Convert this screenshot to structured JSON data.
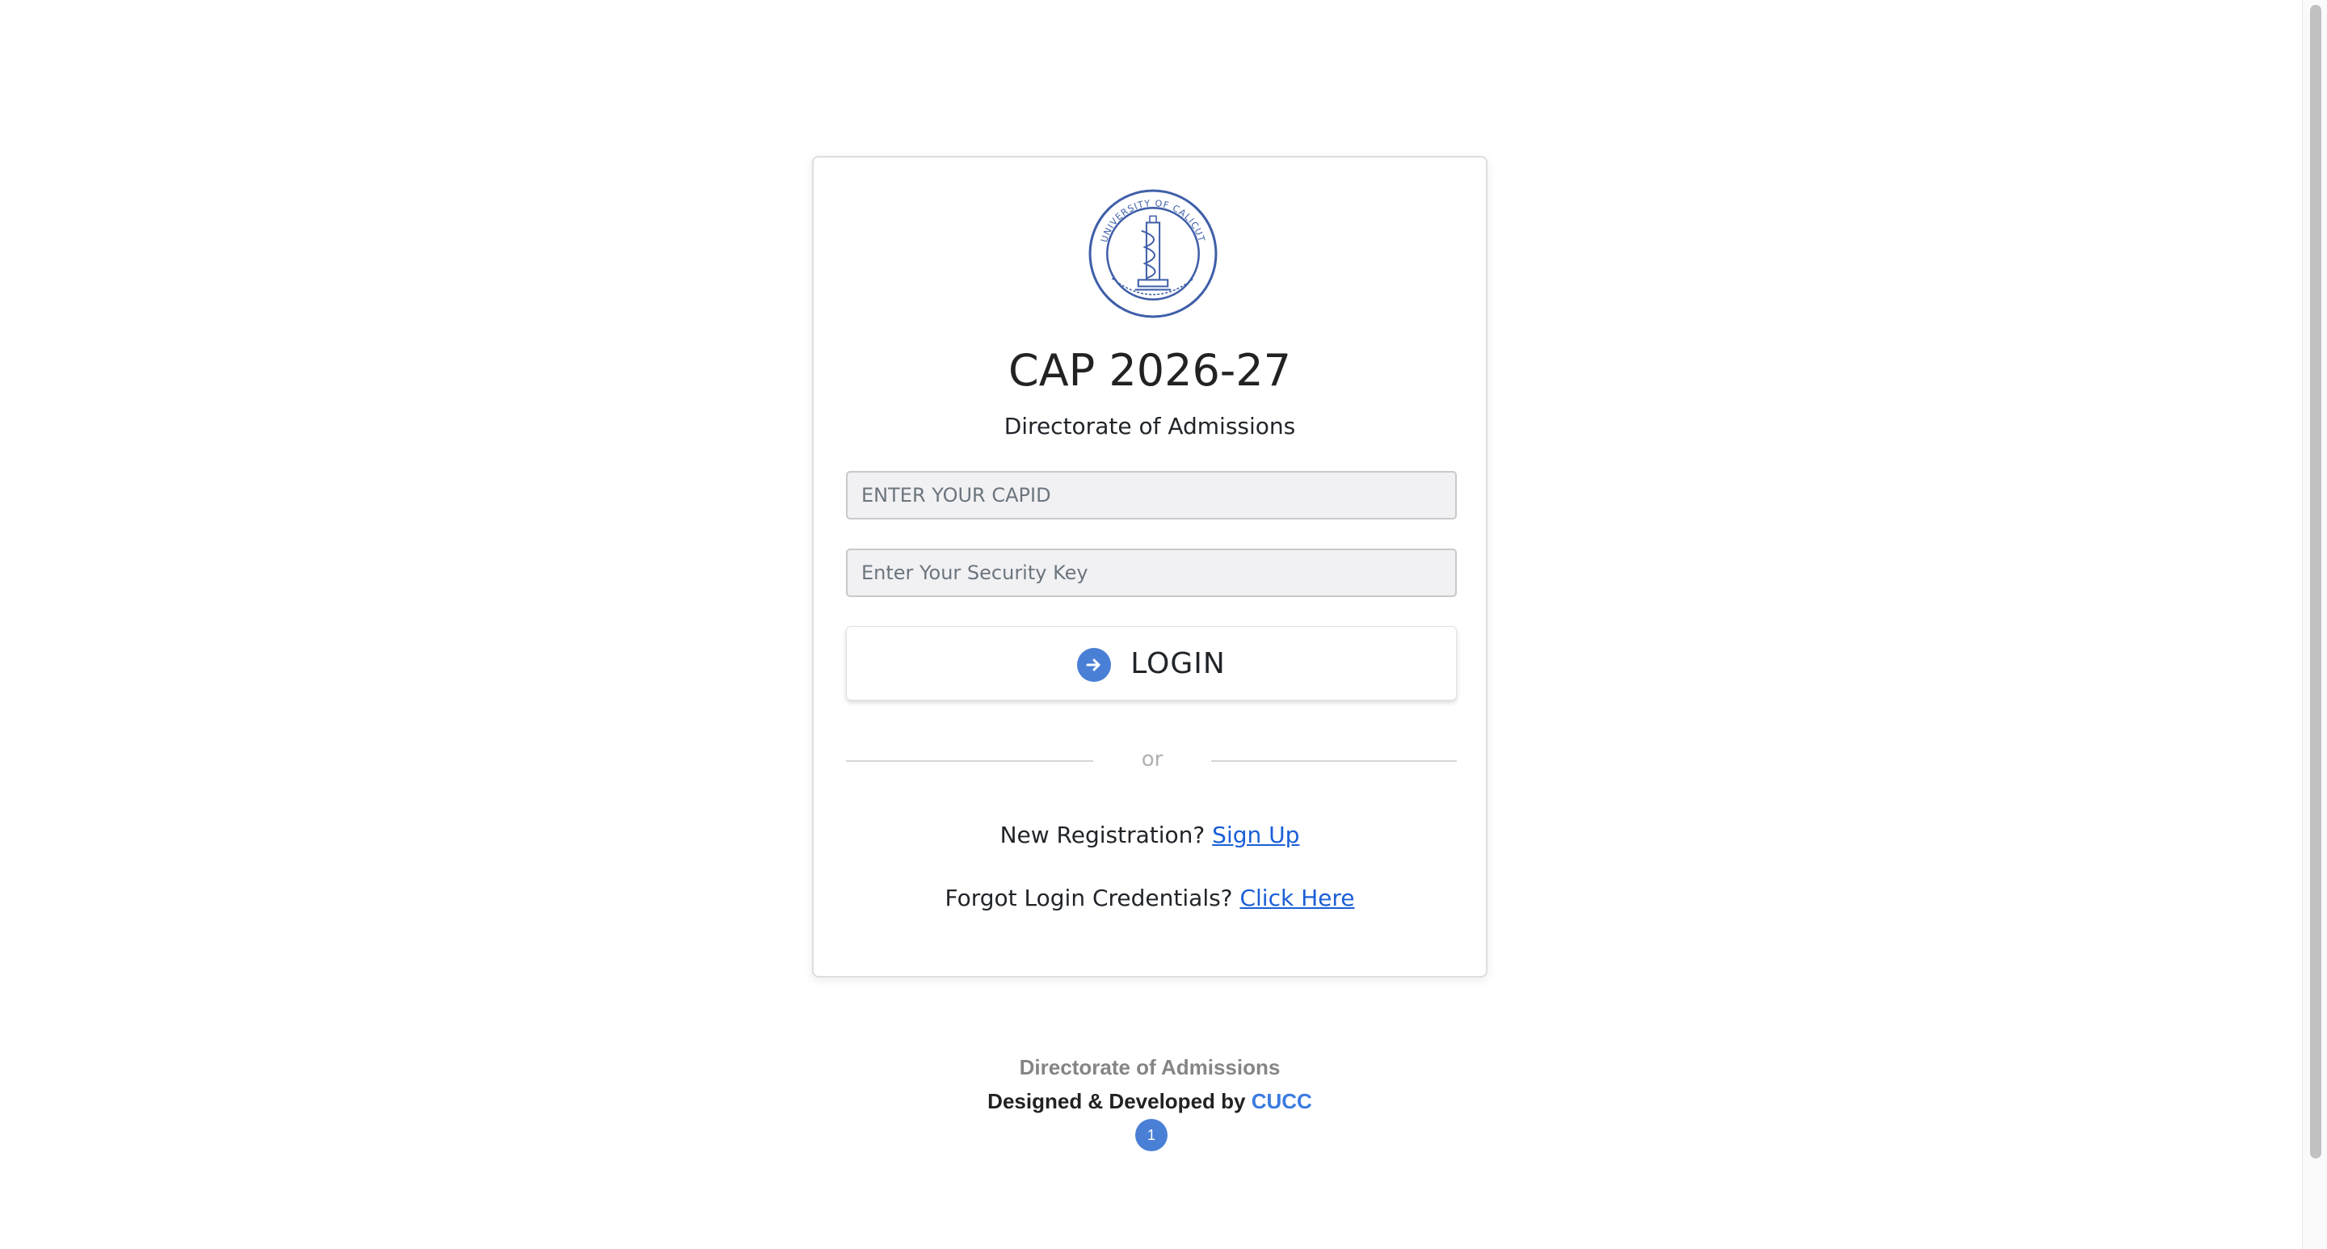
{
  "header": {
    "title": "CAP 2026-27",
    "subtitle": "Directorate of Admissions"
  },
  "logo": {
    "icon": "university-of-calicut-seal",
    "text": "UNIVERSITY OF CALICUT",
    "color": "#3f5fa8"
  },
  "login_form": {
    "capid_placeholder": "ENTER YOUR CAPID",
    "security_key_placeholder": "Enter Your Security Key",
    "login_label": "LOGIN",
    "login_icon": "arrow-right-circle-icon",
    "divider_text": "or"
  },
  "links": {
    "registration_text": "New Registration?",
    "signup_label": "Sign Up",
    "forgot_text": "Forgot Login Credentials?",
    "click_here_label": "Click Here"
  },
  "footer": {
    "line1": "Directorate of Admissions",
    "designed_by": "Designed & Developed by",
    "brand": "CUCC",
    "page_number": "1"
  },
  "colors": {
    "accent": "#4a7fd6",
    "link": "#1a5fd6",
    "brand": "#3b7be0"
  }
}
